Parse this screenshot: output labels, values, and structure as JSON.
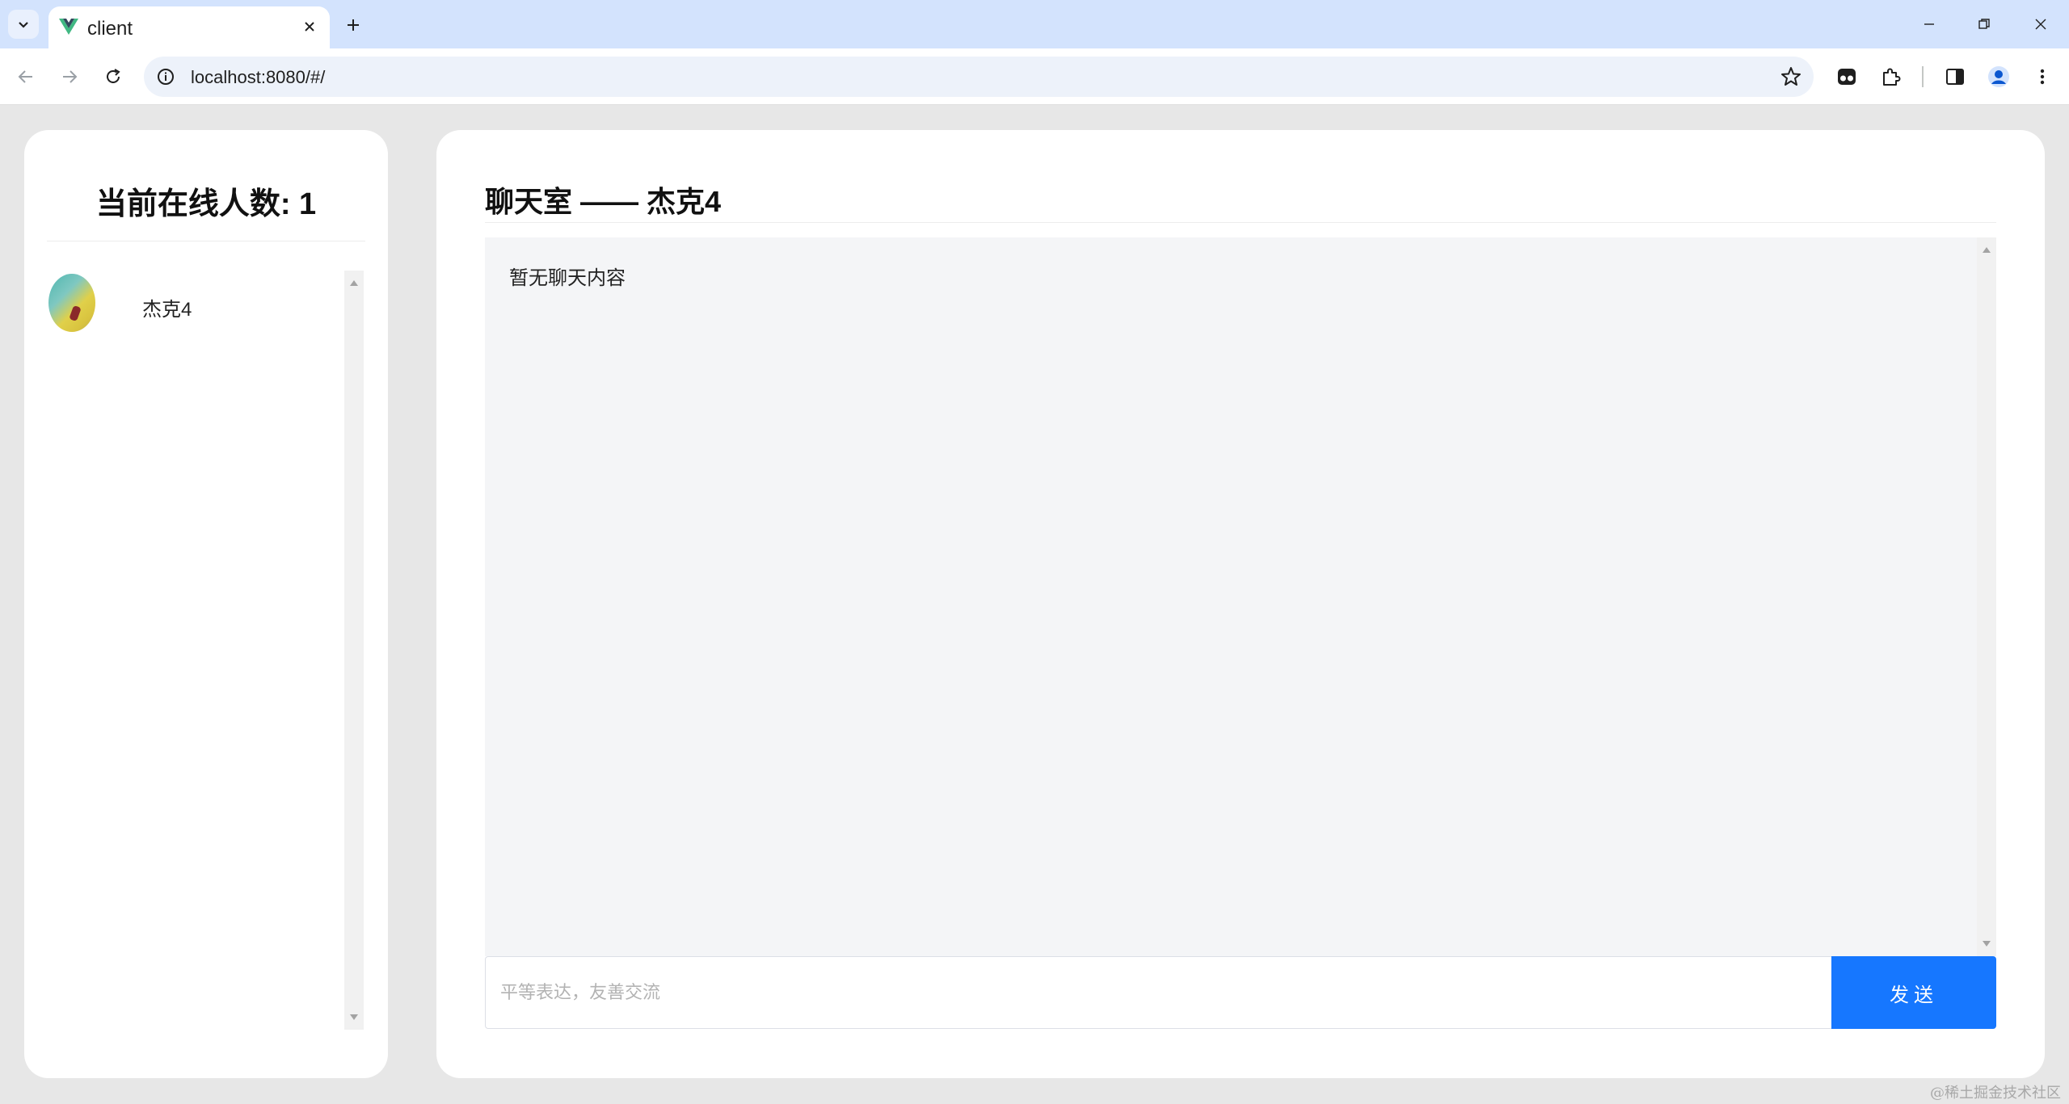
{
  "browser": {
    "tab": {
      "title": "client",
      "favicon": "vue-logo-icon"
    },
    "address": {
      "url": "localhost:8080/#/"
    }
  },
  "sidebar": {
    "online_label": "当前在线人数: 1",
    "users": [
      {
        "name": "杰克4"
      }
    ]
  },
  "chat": {
    "title": "聊天室 —— 杰克4",
    "empty_text": "暂无聊天内容",
    "input_placeholder": "平等表达，友善交流",
    "send_label": "发送"
  },
  "watermark": "@稀土掘金技术社区",
  "colors": {
    "tabstrip": "#d3e3fd",
    "page_bg": "#e7e7e7",
    "send_button": "#1677ff",
    "message_area": "#f4f5f7"
  }
}
